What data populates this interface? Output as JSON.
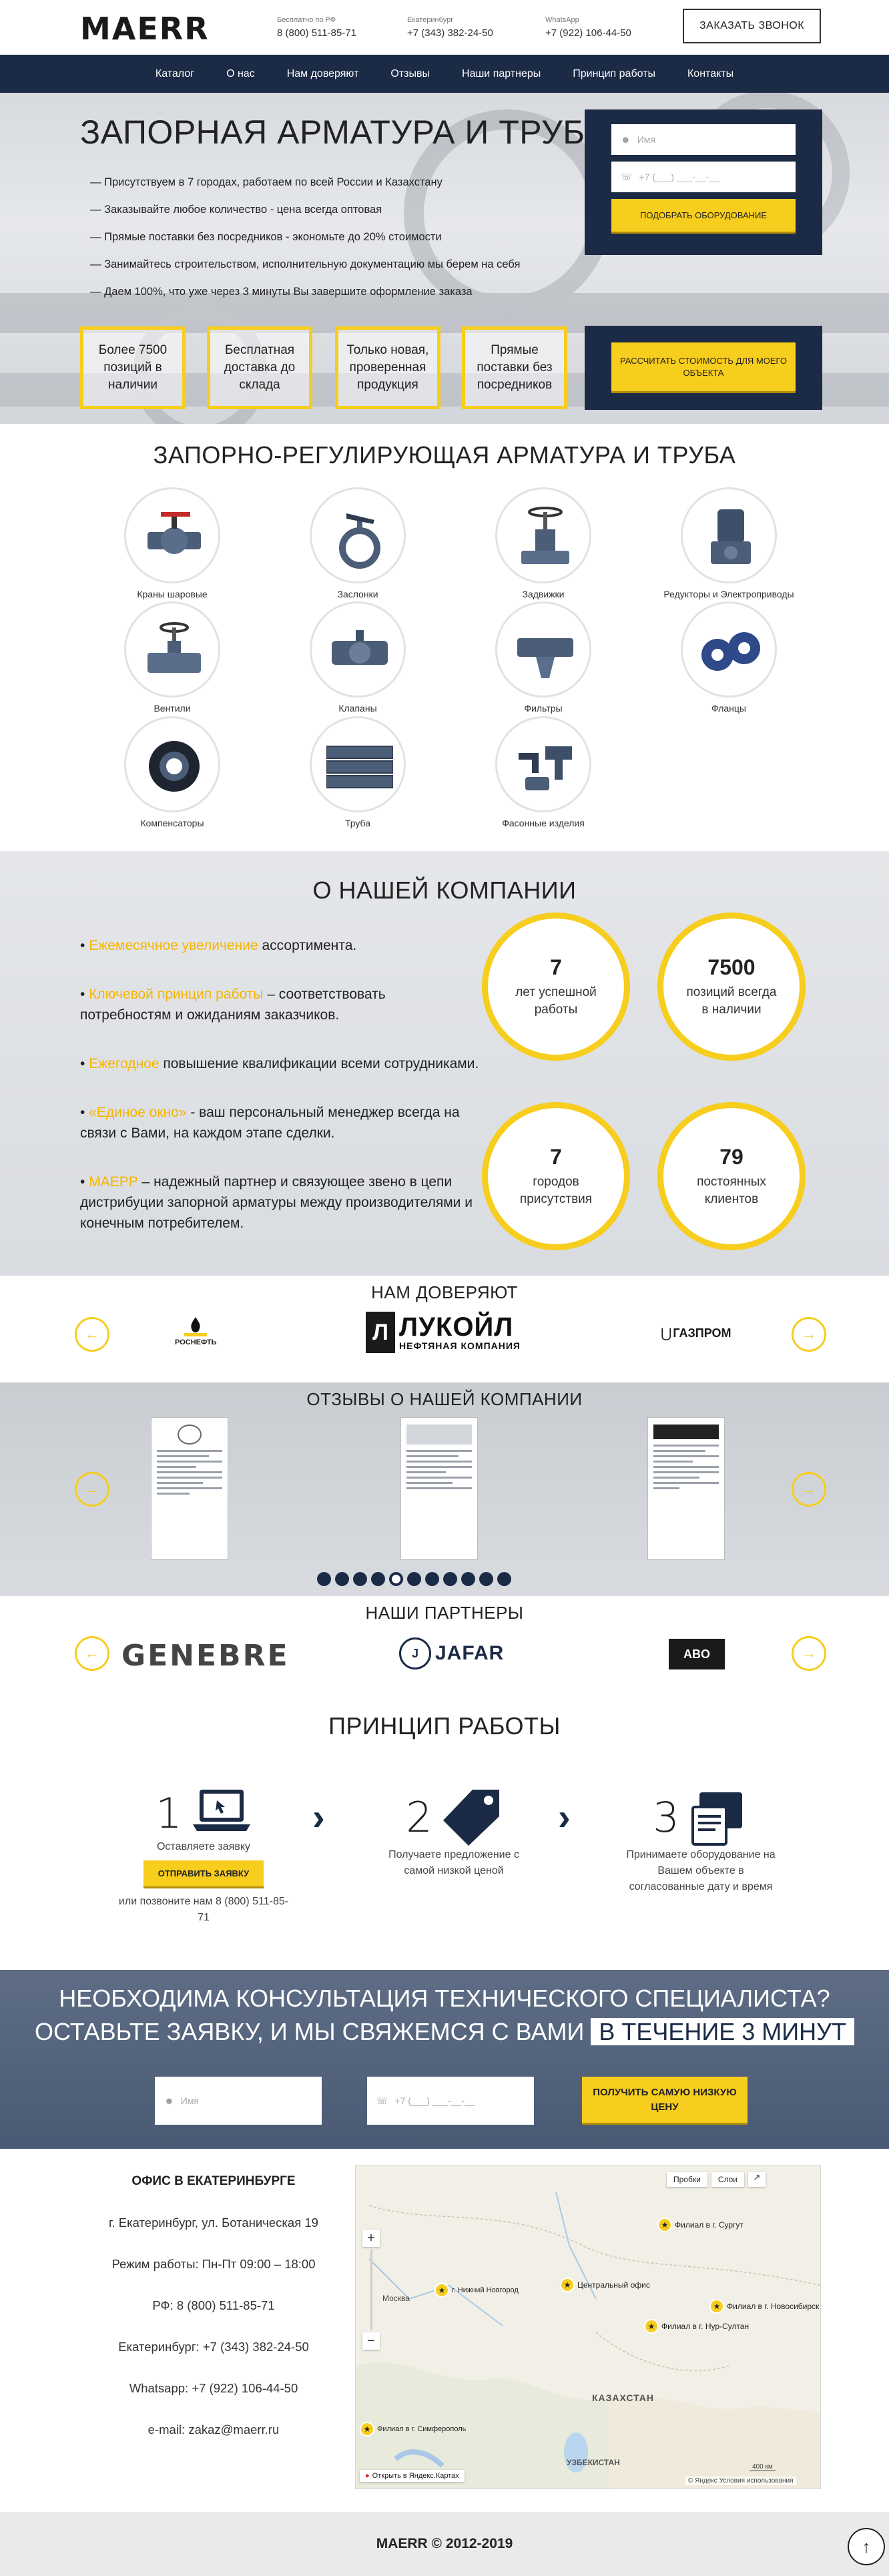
{
  "header": {
    "logo": "MAERR",
    "contacts": [
      {
        "caption": "Бесплатно по РФ",
        "value": "8 (800) 511-85-71"
      },
      {
        "caption": "Екатеринбург",
        "value": "+7 (343) 382-24-50"
      },
      {
        "caption": "WhatsApp",
        "value": "+7 (922) 106-44-50"
      }
    ],
    "call_button": "ЗАКАЗАТЬ ЗВОНОК"
  },
  "nav": [
    "Каталог",
    "О нас",
    "Нам доверяют",
    "Отзывы",
    "Наши партнеры",
    "Принцип работы",
    "Контакты"
  ],
  "hero": {
    "title": "ЗАПОРНАЯ АРМАТУРА И ТРУБА",
    "bullets": [
      "Присутствуем в 7 городах, работаем по всей России и Казахстану",
      "Заказывайте любое количество - цена всегда оптовая",
      "Прямые поставки без посредников - экономьте до 20% стоимости",
      "Занимайтесь строительством, исполнительную документацию мы берем на себя",
      "Даем 100%, что уже через 3 минуты Вы завершите оформление заказа"
    ],
    "form": {
      "name_placeholder": "Имя",
      "phone_placeholder": "+7 (___) ___-__-__",
      "button": "ПОДОБРАТЬ ОБОРУДОВАНИЕ"
    },
    "features": [
      "Более 7500 позиций в наличии",
      "Бесплатная доставка до склада",
      "Только новая, проверенная продукция",
      "Прямые поставки без посредников"
    ],
    "calc_button": "РАССЧИТАТЬ СТОИМОСТЬ ДЛЯ МОЕГО ОБЪЕКТА"
  },
  "catalog": {
    "title": "ЗАПОРНО-РЕГУЛИРУЮЩАЯ АРМАТУРА И ТРУБА",
    "items": [
      "Краны шаровые",
      "Заслонки",
      "Задвижки",
      "Редукторы и Электроприводы",
      "Вентили",
      "Клапаны",
      "Фильтры",
      "Фланцы",
      "Компенсаторы",
      "Труба",
      "Фасонные изделия"
    ]
  },
  "about": {
    "title": "О НАШЕЙ КОМПАНИИ",
    "bullets": [
      {
        "hl": "Ежемесячное увеличение",
        "text": " ассортимента."
      },
      {
        "hl": "Ключевой принцип работы",
        "text": " – соответствовать потребностям и ожиданиям заказчиков."
      },
      {
        "hl": "Ежегодное",
        "text": " повышение квалификации всеми сотрудниками."
      },
      {
        "hl": "«Единое окно»",
        "text": " - ваш персональный менеджер всегда на связи с Вами, на каждом этапе сделки."
      },
      {
        "hl": "МАЕРР",
        "text": " – надежный партнер и связующее звено в цепи дистрибуции запорной арматуры между производителями и конечным потребителем."
      }
    ],
    "stats": [
      {
        "n": "7",
        "t": "лет успешной работы"
      },
      {
        "n": "7500",
        "t": "позиций всегда в наличии"
      },
      {
        "n": "7",
        "t": "городов присутствия"
      },
      {
        "n": "79",
        "t": "постоянных клиентов"
      }
    ]
  },
  "trust": {
    "title": "НАМ ДОВЕРЯЮТ",
    "brands": [
      "РОСНЕФТЬ",
      "ЛУКОЙЛ",
      "НЕФТЯНАЯ КОМПАНИЯ",
      "ГАЗПРОМ"
    ]
  },
  "reviews": {
    "title": "ОТЗЫВЫ О НАШЕЙ КОМПАНИИ",
    "dots_total": 11,
    "dots_active_index": 4
  },
  "partners": {
    "title": "НАШИ ПАРТНЕРЫ",
    "brands": [
      "GENEBRE",
      "JAFAR",
      "ABO"
    ]
  },
  "principle": {
    "title": "ПРИНЦИП РАБОТЫ",
    "steps": [
      {
        "num": "1",
        "text": "Оставляете заявку",
        "button": "ОТПРАВИТЬ ЗАЯВКУ",
        "sub": "или позвоните нам 8 (800) 511-85-71"
      },
      {
        "num": "2",
        "text": "Получаете предложение с самой низкой ценой"
      },
      {
        "num": "3",
        "text": "Принимаете оборудование на Вашем объекте в согласованные дату и время"
      }
    ]
  },
  "cta": {
    "line1": "НЕОБХОДИМА КОНСУЛЬТАЦИЯ ТЕХНИЧЕСКОГО СПЕЦИАЛИСТА?",
    "line2": "ОСТАВЬТЕ ЗАЯВКУ, И МЫ СВЯЖЕМСЯ С ВАМИ",
    "line2_box": "В ТЕЧЕНИЕ 3 МИНУТ",
    "name_placeholder": "Имя",
    "phone_placeholder": "+7 (___) ___-__-__",
    "button": "ПОЛУЧИТЬ САМУЮ НИЗКУЮ ЦЕНУ"
  },
  "office": {
    "title": "ОФИС В ЕКАТЕРИНБУРГЕ",
    "rows": [
      "г. Екатеринбург, ул. Ботаническая 19",
      "Режим работы: Пн-Пт 09:00 – 18:00",
      "РФ: 8 (800) 511-85-71",
      "Екатеринбург: +7 (343) 382-24-50",
      "Whatsapp: +7 (922) 106-44-50",
      "e-mail: zakaz@maerr.ru"
    ],
    "map": {
      "controls": [
        "Пробки",
        "Слои"
      ],
      "markers": [
        "Филиал в г. Сургут",
        "г. Нижний Новгород",
        "Центральный офис",
        "Филиал в г. Новосибирск",
        "Филиал в г. Нур-Султан",
        "Филиал в г. Симферополь"
      ],
      "cities": [
        "Москва",
        "КАЗАХСТАН",
        "УЗБЕКИСТАН"
      ],
      "footer_left": "Открыть в Яндекс.Картах",
      "scale": "400 км",
      "footer_right": "© Яндекс Условия использования"
    }
  },
  "footer": {
    "copyright": "MAERR © 2012-2019"
  }
}
